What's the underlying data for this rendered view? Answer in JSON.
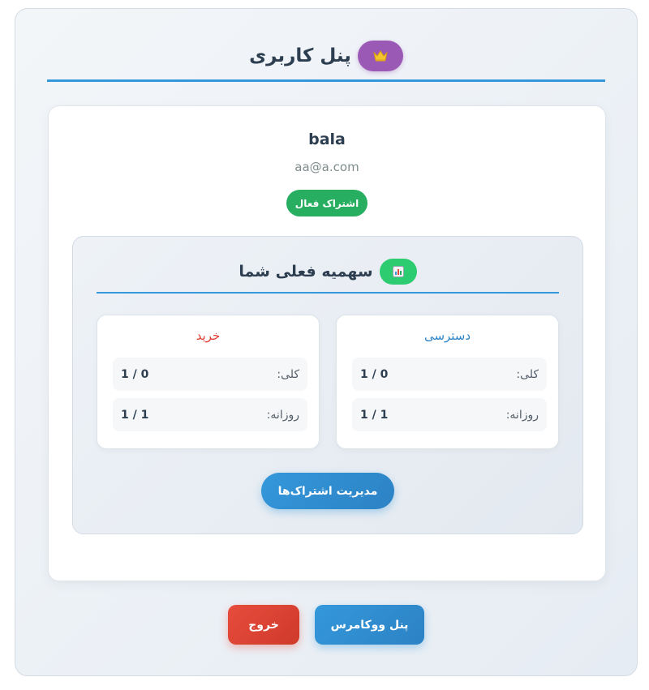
{
  "header": {
    "title": "پنل کاربری",
    "icon": "crown-icon",
    "badge_color": "#9b59b6"
  },
  "profile": {
    "username": "bala",
    "email": "aa@a.com",
    "status": "اشتراک فعال",
    "status_color": "#27ae60"
  },
  "quota": {
    "title": "سهمیه فعلی شما",
    "icon": "bar-chart-icon",
    "badge_color": "#2ecc71",
    "access": {
      "title": "دسترسی",
      "color": "#2f86c8",
      "rows": [
        {
          "label": "کلی:",
          "value": "1 / 0"
        },
        {
          "label": "روزانه:",
          "value": "1 / 1"
        }
      ]
    },
    "purchase": {
      "title": "خرید",
      "color": "#e03b2f",
      "rows": [
        {
          "label": "کلی:",
          "value": "1 / 0"
        },
        {
          "label": "روزانه:",
          "value": "1 / 1"
        }
      ]
    },
    "manage_button": "مدیریت اشتراک‌ها"
  },
  "actions": {
    "woocommerce_button": "پنل ووکامرس",
    "logout_button": "خروج"
  },
  "colors": {
    "accent": "#3498db",
    "danger": "#e74c3c"
  }
}
